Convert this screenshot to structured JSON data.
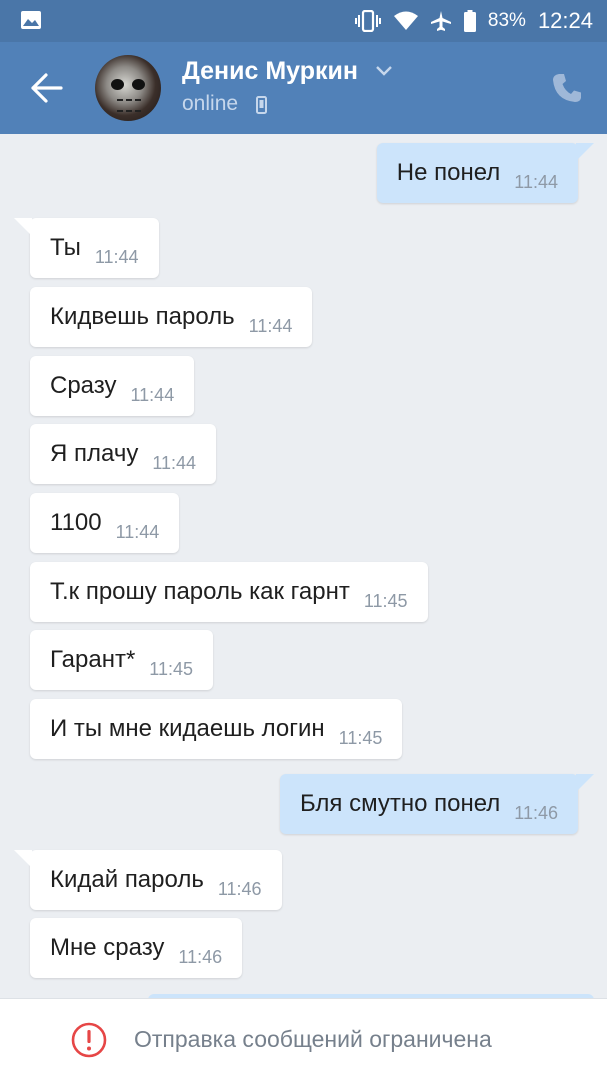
{
  "status_bar": {
    "battery_percent": "83%",
    "time": "12:24"
  },
  "header": {
    "contact_name": "Денис Муркин",
    "status": "online"
  },
  "messages": [
    {
      "direction": "out",
      "text": "Не понел",
      "time": "11:44"
    },
    {
      "direction": "in",
      "text": "Ты",
      "time": "11:44"
    },
    {
      "direction": "in",
      "text": "Кидвешь пароль",
      "time": "11:44"
    },
    {
      "direction": "in",
      "text": "Сразу",
      "time": "11:44"
    },
    {
      "direction": "in",
      "text": "Я плачу",
      "time": "11:44"
    },
    {
      "direction": "in",
      "text": "1100",
      "time": "11:44"
    },
    {
      "direction": "in",
      "text": "Т.к прошу пароль как гарнт",
      "time": "11:45"
    },
    {
      "direction": "in",
      "text": "Гарант*",
      "time": "11:45"
    },
    {
      "direction": "in",
      "text": "И ты мне кидаешь логин",
      "time": "11:45"
    },
    {
      "direction": "out",
      "text": "Бля смутно понел",
      "time": "11:46"
    },
    {
      "direction": "in",
      "text": "Кидай пароль",
      "time": "11:46"
    },
    {
      "direction": "in",
      "text": "Мне сразу",
      "time": "11:46"
    }
  ],
  "footer": {
    "notice": "Отправка сообщений ограничена"
  },
  "colors": {
    "header": "#5181b8",
    "status_bar": "#4a76a8",
    "outgoing_bubble": "#cce4fb",
    "incoming_bubble": "#ffffff",
    "chat_background": "#ebeef2",
    "warning": "#e64646"
  }
}
